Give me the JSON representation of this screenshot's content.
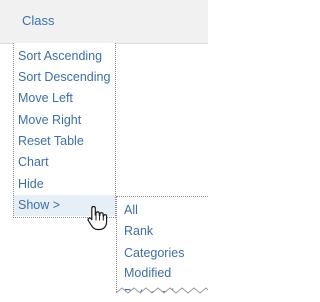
{
  "header": {
    "label": "Class"
  },
  "menu": {
    "items": [
      {
        "label": "Sort Ascending"
      },
      {
        "label": "Sort Descending"
      },
      {
        "label": "Move Left"
      },
      {
        "label": "Move Right"
      },
      {
        "label": "Reset Table"
      },
      {
        "label": "Chart"
      },
      {
        "label": "Hide"
      },
      {
        "label": "Show >"
      }
    ]
  },
  "submenu": {
    "items": [
      {
        "label": "All"
      },
      {
        "label": "Rank"
      },
      {
        "label": "Categories"
      },
      {
        "label": "Modified"
      },
      {
        "label": "Detected"
      }
    ]
  },
  "cursor": {
    "icon": "hand-pointer-icon"
  }
}
